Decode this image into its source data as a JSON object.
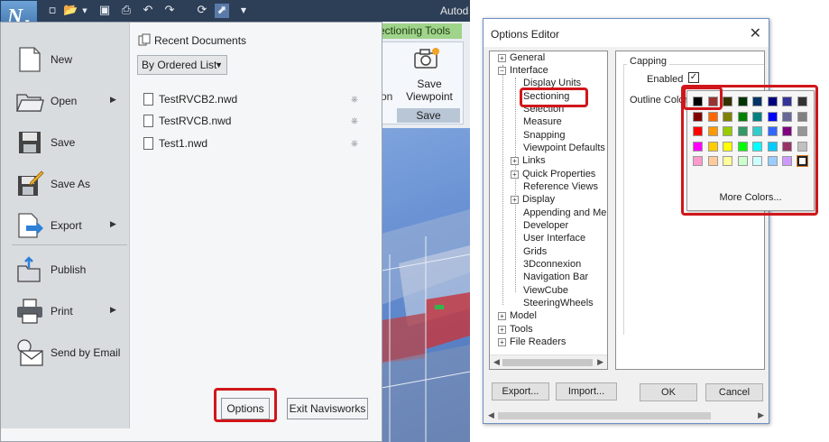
{
  "app": {
    "title": "Autod",
    "logo_letter": "N",
    "ribbon_tab": "ectioning Tools",
    "ribbon_partial_label": "on",
    "save_viewpoint_line1": "Save",
    "save_viewpoint_line2": "Viewpoint",
    "panel_title": "Save"
  },
  "menu": {
    "items": [
      {
        "label": "New",
        "icon": "new-document-icon"
      },
      {
        "label": "Open",
        "icon": "open-folder-icon",
        "submenu": true
      },
      {
        "label": "Save",
        "icon": "floppy-disk-icon"
      },
      {
        "label": "Save As",
        "icon": "save-as-icon"
      },
      {
        "label": "Export",
        "icon": "export-icon",
        "submenu": true
      },
      {
        "label": "Publish",
        "icon": "publish-icon"
      },
      {
        "label": "Print",
        "icon": "printer-icon",
        "submenu": true
      },
      {
        "label": "Send by Email",
        "icon": "email-icon"
      }
    ],
    "recent_heading": "Recent Documents",
    "sort_select": "By Ordered List",
    "recent_files": [
      "TestRVCB2.nwd",
      "TestRVCB.nwd",
      "Test1.nwd"
    ],
    "options_button": "Options",
    "exit_button": "Exit Navisworks"
  },
  "dialog": {
    "title": "Options Editor",
    "tree": [
      {
        "label": "General",
        "expander": "+"
      },
      {
        "label": "Interface",
        "expander": "-"
      },
      {
        "label": "Display Units"
      },
      {
        "label": "Sectioning",
        "selected": true
      },
      {
        "label": "Selection"
      },
      {
        "label": "Measure"
      },
      {
        "label": "Snapping"
      },
      {
        "label": "Viewpoint Defaults"
      },
      {
        "label": "Links",
        "expander": "+"
      },
      {
        "label": "Quick Properties",
        "expander": "+"
      },
      {
        "label": "Reference Views"
      },
      {
        "label": "Display",
        "expander": "+"
      },
      {
        "label": "Appending and Mergir"
      },
      {
        "label": "Developer"
      },
      {
        "label": "User Interface"
      },
      {
        "label": "Grids"
      },
      {
        "label": "3Dconnexion"
      },
      {
        "label": "Navigation Bar"
      },
      {
        "label": "ViewCube"
      },
      {
        "label": "SteeringWheels"
      },
      {
        "label": "Model",
        "expander": "+"
      },
      {
        "label": "Tools",
        "expander": "+"
      },
      {
        "label": "File Readers",
        "expander": "+"
      }
    ],
    "group_title": "Capping",
    "enabled_label": "Enabled",
    "enabled_checked": true,
    "outline_color_label": "Outline Color",
    "outline_color_value": "#ffffff",
    "more_colors": "More Colors...",
    "palette": [
      [
        "#000000",
        "#993333",
        "#333300",
        "#003300",
        "#003366",
        "#000080",
        "#333399",
        "#333333"
      ],
      [
        "#800000",
        "#ff6600",
        "#808000",
        "#008000",
        "#008080",
        "#0000ff",
        "#666699",
        "#808080"
      ],
      [
        "#ff0000",
        "#ff9900",
        "#99cc00",
        "#339966",
        "#33cccc",
        "#3366ff",
        "#800080",
        "#969696"
      ],
      [
        "#ff00ff",
        "#ffcc00",
        "#ffff00",
        "#00ff00",
        "#00ffff",
        "#00ccff",
        "#993366",
        "#c0c0c0"
      ],
      [
        "#ff99cc",
        "#ffcc99",
        "#ffff99",
        "#ccffcc",
        "#ccffff",
        "#99ccff",
        "#cc99ff",
        "#ffffff"
      ]
    ],
    "export_button": "Export...",
    "import_button": "Import...",
    "ok_button": "OK",
    "cancel_button": "Cancel"
  },
  "colors": {
    "highlight": "#d0161b",
    "title_bar": "#2d3e57",
    "ribbon_context_tab": "#9fd48a"
  }
}
